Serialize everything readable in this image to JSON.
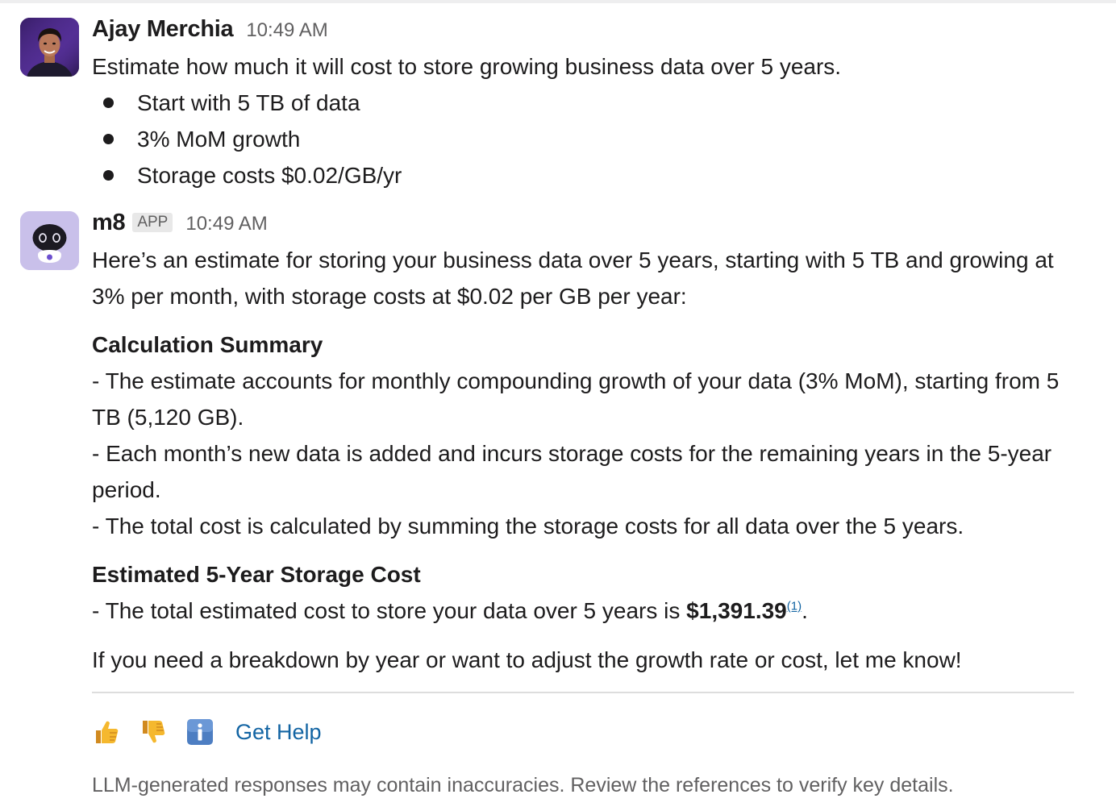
{
  "messages": {
    "user": {
      "name": "Ajay Merchia",
      "time": "10:49 AM",
      "text": "Estimate how much it will cost to store growing business data over 5 years.",
      "bullets": [
        "Start with 5 TB of data",
        "3% MoM growth",
        "Storage costs $0.02/GB/yr"
      ]
    },
    "bot": {
      "name": "m8",
      "badge": "APP",
      "time": "10:49 AM",
      "intro": "Here’s an estimate for storing your business data over 5 years, starting with 5 TB and growing at 3% per month, with storage costs at $0.02 per GB per year:",
      "summary_heading": "Calculation Summary",
      "summary_lines": [
        "- The estimate accounts for monthly compounding growth of your data (3% MoM), starting from 5 TB (5,120 GB).",
        "- Each month’s new data is added and incurs storage costs for the remaining years in the 5-year period.",
        "- The total cost is calculated by summing the storage costs for all data over the 5 years."
      ],
      "cost_heading": "Estimated 5-Year Storage Cost",
      "cost_prefix": "- The total estimated cost to store your data over 5 years is ",
      "cost_value": "$1,391.39",
      "cost_ref": "(1)",
      "cost_suffix": ".",
      "closing": "If you need a breakdown by year or want to adjust the growth rate or cost, let me know!",
      "actions": {
        "thumbs_up_icon": "thumbs-up-icon",
        "thumbs_down_icon": "thumbs-down-icon",
        "info_icon": "info-icon",
        "get_help": "Get Help"
      },
      "disclaimer": "LLM-generated responses may contain inaccuracies. Review the references to verify key details."
    }
  },
  "colors": {
    "link": "#1264a3",
    "muted": "#616061",
    "text": "#1d1c1d"
  }
}
